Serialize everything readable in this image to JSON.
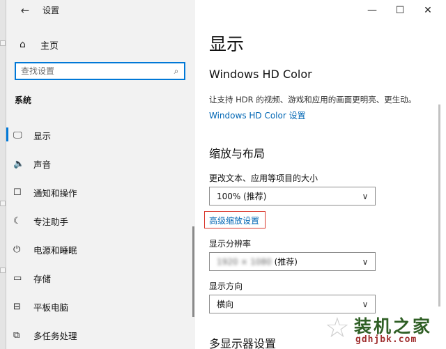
{
  "window": {
    "title": "设置",
    "controls": {
      "minimize": "—",
      "maximize": "☐",
      "close": "✕"
    }
  },
  "sidebar": {
    "home_label": "主页",
    "search_placeholder": "查找设置",
    "section_label": "系统",
    "items": [
      {
        "label": "显示",
        "icon": "monitor-icon",
        "glyph": "🖵",
        "selected": true
      },
      {
        "label": "声音",
        "icon": "speaker-icon",
        "glyph": "🔈",
        "selected": false
      },
      {
        "label": "通知和操作",
        "icon": "notification-icon",
        "glyph": "☐",
        "selected": false
      },
      {
        "label": "专注助手",
        "icon": "moon-icon",
        "glyph": "☾",
        "selected": false
      },
      {
        "label": "电源和睡眠",
        "icon": "power-icon",
        "glyph": "⏻",
        "selected": false
      },
      {
        "label": "存储",
        "icon": "storage-icon",
        "glyph": "▭",
        "selected": false
      },
      {
        "label": "平板电脑",
        "icon": "tablet-icon",
        "glyph": "⊟",
        "selected": false
      },
      {
        "label": "多任务处理",
        "icon": "multitask-icon",
        "glyph": "⧉",
        "selected": false
      }
    ]
  },
  "content": {
    "page_title": "显示",
    "hd_color": {
      "heading": "Windows HD Color",
      "description": "让支持 HDR 的视频、游戏和应用的画面更明亮、更生动。",
      "link": "Windows HD Color 设置"
    },
    "scale_layout": {
      "heading": "缩放与布局",
      "text_size_label": "更改文本、应用等项目的大小",
      "text_size_value": "100% (推荐)",
      "advanced_link": "高级缩放设置",
      "resolution_label": "显示分辨率",
      "resolution_value": "1920 × 1080",
      "resolution_suffix": " (推荐)",
      "orientation_label": "显示方向",
      "orientation_value": "横向"
    },
    "multi_display_heading": "多显示器设置"
  },
  "watermark": {
    "text": "装机之家",
    "url": "gdhjbk.com"
  },
  "colors": {
    "accent": "#0078d7",
    "link": "#0066b4",
    "highlight_box": "#d9362b",
    "sidebar_bg": "#f2f2f2"
  }
}
